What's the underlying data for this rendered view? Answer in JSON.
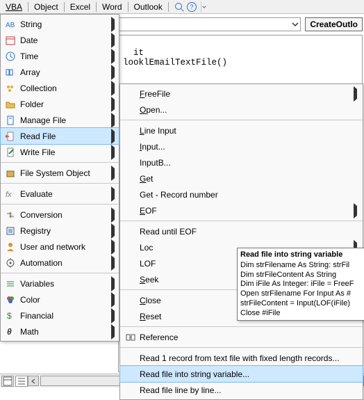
{
  "menubar": {
    "items": [
      "VBA",
      "Object",
      "Excel",
      "Word",
      "Outlook"
    ]
  },
  "toolbar": {
    "combo_value": "",
    "big_button": "CreateOutlo"
  },
  "code": {
    "line1": "it",
    "line2": "looklEmailTextFile()"
  },
  "menu1": {
    "items": [
      {
        "label": "String",
        "icon": "string-icon",
        "arrow": true
      },
      {
        "label": "Date",
        "icon": "date-icon",
        "arrow": true
      },
      {
        "label": "Time",
        "icon": "time-icon",
        "arrow": true
      },
      {
        "label": "Array",
        "icon": "array-icon",
        "arrow": true
      },
      {
        "label": "Collection",
        "icon": "collection-icon",
        "arrow": true
      },
      {
        "label": "Folder",
        "icon": "folder-icon",
        "arrow": true
      },
      {
        "label": "Manage File",
        "icon": "manage-file-icon",
        "arrow": true
      },
      {
        "label": "Read File",
        "icon": "read-file-icon",
        "arrow": true,
        "highlight": true
      },
      {
        "label": "Write File",
        "icon": "write-file-icon",
        "arrow": true
      },
      {
        "label": "File System Object",
        "icon": "fso-icon",
        "arrow": true,
        "dividerBefore": true
      },
      {
        "label": "Evaluate",
        "icon": "fx-icon",
        "arrow": true,
        "dividerBefore": true
      },
      {
        "label": "Conversion",
        "icon": "conversion-icon",
        "arrow": true,
        "dividerBefore": true
      },
      {
        "label": "Registry",
        "icon": "registry-icon",
        "arrow": true
      },
      {
        "label": "User and network",
        "icon": "user-icon",
        "arrow": true
      },
      {
        "label": "Automation",
        "icon": "automation-icon",
        "arrow": true
      },
      {
        "label": "Variables",
        "icon": "variables-icon",
        "arrow": true,
        "dividerBefore": true
      },
      {
        "label": "Color",
        "icon": "color-icon",
        "arrow": true
      },
      {
        "label": "Financial",
        "icon": "financial-icon",
        "arrow": true
      },
      {
        "label": "Math",
        "icon": "math-icon",
        "arrow": true
      }
    ]
  },
  "menu2": {
    "items": [
      {
        "label": "FreeFile",
        "arrow": true,
        "underline": true
      },
      {
        "label": "Open...",
        "underline": true,
        "dividerAfter": true
      },
      {
        "label": "Line Input",
        "underline": true
      },
      {
        "label": "Input...",
        "underline": true
      },
      {
        "label": "InputB..."
      },
      {
        "label": "Get",
        "underline": true
      },
      {
        "label": "Get - Record number"
      },
      {
        "label": "EOF",
        "arrow": true,
        "underline": true,
        "dividerAfter": true
      },
      {
        "label": "Read until EOF"
      },
      {
        "label": "Loc",
        "arrow": true
      },
      {
        "label": "LOF"
      },
      {
        "label": "Seek",
        "underline": true,
        "dividerAfter": true
      },
      {
        "label": "Close",
        "underline": true
      },
      {
        "label": "Reset",
        "underline": true,
        "dividerAfter": true
      },
      {
        "label": "Reference",
        "icon": "reference-icon",
        "dividerAfter": true
      },
      {
        "label": "Read 1 record from text file with fixed length records..."
      },
      {
        "label": "Read file into string variable...",
        "highlight": true
      },
      {
        "label": "Read file line by line..."
      }
    ]
  },
  "tooltip": {
    "title": "Read file into string variable",
    "lines": [
      "Dim strFilename As String: strFil",
      "Dim strFileContent As String",
      "Dim iFile As Integer: iFile = FreeF",
      "Open strFilename For Input As #",
      "strFileContent = Input(LOF(iFile)",
      "Close #iFile"
    ]
  }
}
